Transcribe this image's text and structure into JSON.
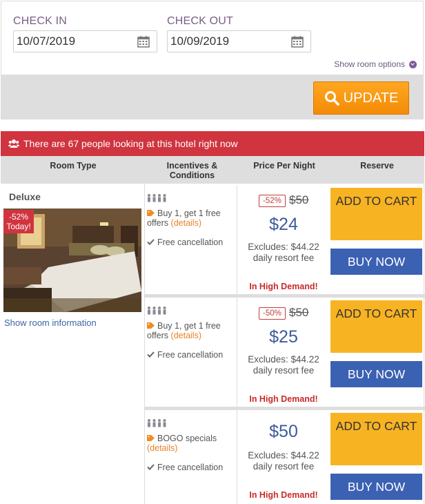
{
  "dates": {
    "check_in_label": "CHECK IN",
    "check_in_value": "10/07/2019",
    "check_out_label": "CHECK OUT",
    "check_out_value": "10/09/2019"
  },
  "room_options_label": "Show room options",
  "update_label": "UPDATE",
  "alert_text": "There are 67 people looking at this hotel right now",
  "table_headers": {
    "room_type": "Room Type",
    "incentives": "Incentives & Conditions",
    "price": "Price Per Night",
    "reserve": "Reserve"
  },
  "room": {
    "name": "Deluxe",
    "badge_pct": "-52%",
    "badge_text": "Today!",
    "show_info": "Show room information"
  },
  "offers": [
    {
      "offer_text": "Buy 1, get 1 free offers",
      "details": "(details)",
      "cancellation": "Free cancellation",
      "discount": "-52%",
      "old_price": "$50",
      "price": "$24",
      "excludes": "Excludes: $44.22 daily resort fee",
      "demand": "In High Demand!",
      "add_to_cart": "ADD TO CART",
      "buy_now": "BUY NOW"
    },
    {
      "offer_text": "Buy 1, get 1 free offers",
      "details": "(details)",
      "cancellation": "Free cancellation",
      "discount": "-50%",
      "old_price": "$50",
      "price": "$25",
      "excludes": "Excludes: $44.22 daily resort fee",
      "demand": "In High Demand!",
      "add_to_cart": "ADD TO CART",
      "buy_now": "BUY NOW"
    },
    {
      "offer_text": "BOGO specials",
      "details": "(details)",
      "cancellation": "Free cancellation",
      "discount": "",
      "old_price": "",
      "price": "$50",
      "excludes": "Excludes: $44.22 daily resort fee",
      "demand": "In High Demand!",
      "add_to_cart": "ADD TO CART",
      "buy_now": "BUY NOW"
    }
  ],
  "colors": {
    "accent_orange": "#f48b06",
    "alert_red": "#d0343f",
    "cart_yellow": "#f8b322",
    "buy_blue": "#3b61b3",
    "price_blue": "#3e5a9b"
  }
}
